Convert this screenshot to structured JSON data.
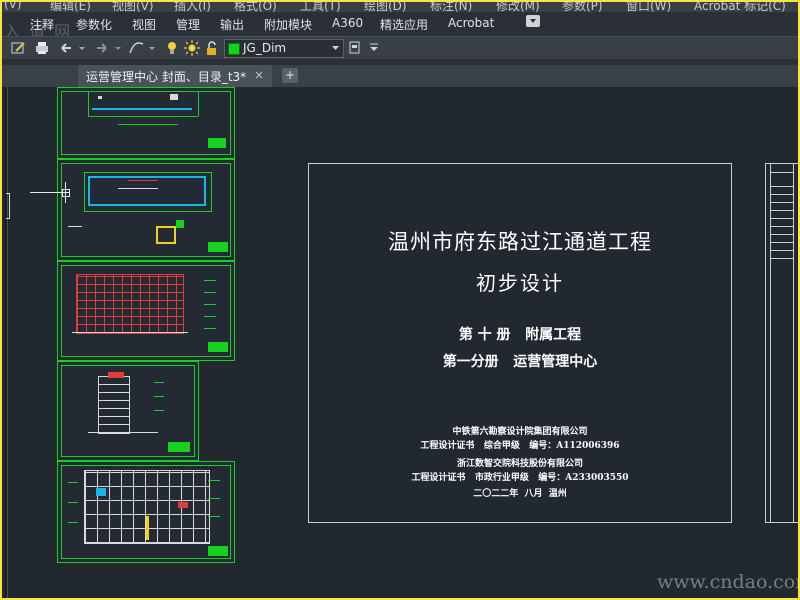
{
  "menubar": {
    "items": [
      "(V)",
      "编辑(E)",
      "视图(V)",
      "插入(I)",
      "格式(O)",
      "工具(T)",
      "绘图(D)",
      "标注(N)",
      "修改(M)",
      "参数(P)",
      "窗口(W)",
      "Acrobat 标记(C)"
    ]
  },
  "ribbon": {
    "watermark": "入 道 网",
    "tabs": [
      "注释",
      "参数化",
      "视图",
      "管理",
      "输出",
      "附加模块",
      "A360",
      "精选应用",
      "Acrobat"
    ]
  },
  "toolbar": {
    "layer_name": "JG_Dim",
    "layer_color": "#12d61a"
  },
  "document": {
    "tab_label": "运营管理中心 封面、目录_t3*",
    "close_glyph": "×",
    "new_tab_glyph": "+"
  },
  "sheet": {
    "project_title": "温州市府东路过江通道工程",
    "stage": "初步设计",
    "volume": "第 十 册   附属工程",
    "subvolume": "第一分册   运营管理中心",
    "credits": [
      "中铁第六勘察设计院集团有限公司",
      "工程设计证书   综合甲级   编号：A112006396",
      "浙江数智交院科技股份有限公司",
      "工程设计证书   市政行业甲级   编号：A233003550",
      "二〇二二年  八月  温州"
    ]
  },
  "watermark": "www.cndao.com",
  "colors": {
    "canvas_bg": "#212830",
    "frame_border": "#f6e73a",
    "drawing_green": "#16d21e",
    "drawing_cyan": "#18b7e6"
  }
}
